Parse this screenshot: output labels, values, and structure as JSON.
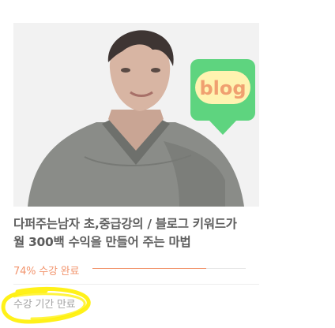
{
  "course": {
    "title_line1": "다퍼주는남자 초,중급강의 / 블로그 키워드가",
    "title_line2": "월 300백 수익을 만들어 주는 마법",
    "badge_text": "blog",
    "progress_text": "74% 수강 완료",
    "progress_value": 0.74,
    "status_text": "수강 기간 만료"
  },
  "colors": {
    "accent": "#f2956e",
    "badge_green": "#5ed47f",
    "badge_text": "#f0a070",
    "highlight": "#fff000"
  }
}
